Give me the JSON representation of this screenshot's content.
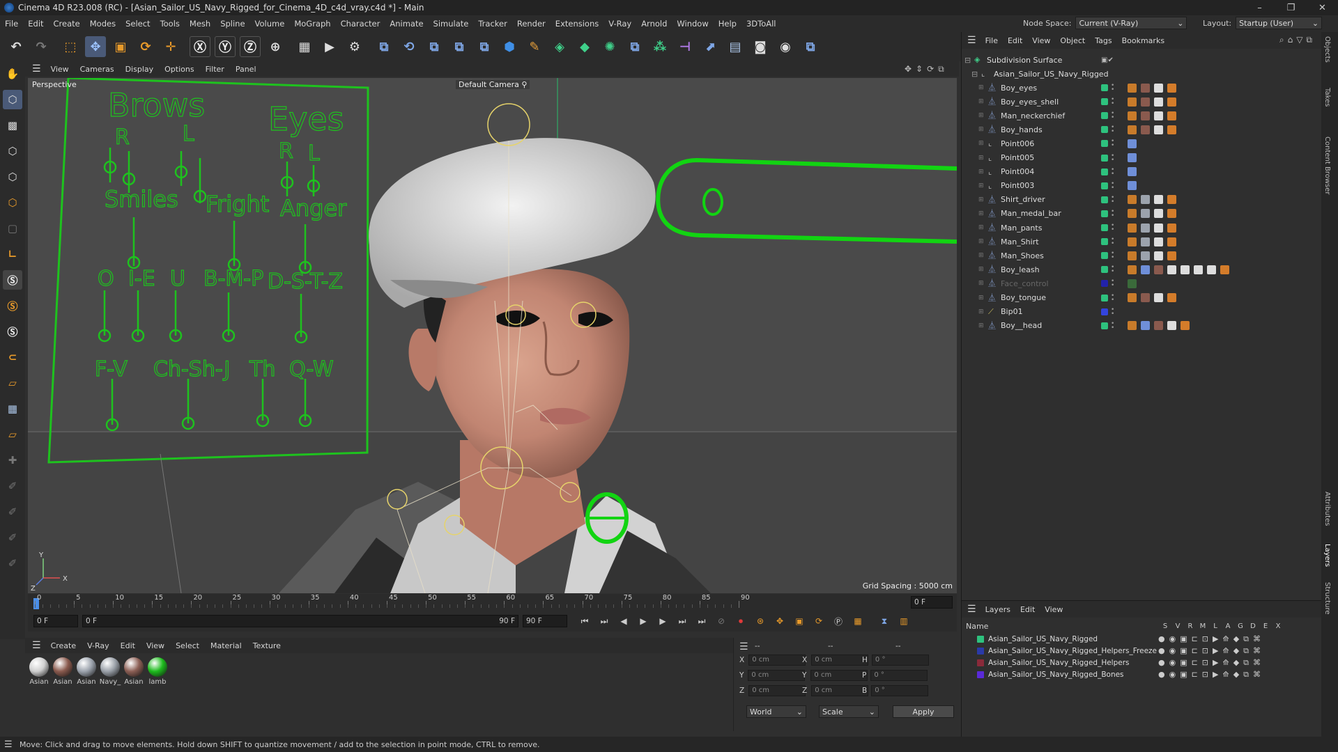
{
  "window": {
    "title": "Cinema 4D R23.008 (RC) - [Asian_Sailor_US_Navy_Rigged_for_Cinema_4D_c4d_vray.c4d *] - Main",
    "controls": [
      "–",
      "❐",
      "✕"
    ]
  },
  "menubar": {
    "items": [
      "File",
      "Edit",
      "Create",
      "Modes",
      "Select",
      "Tools",
      "Mesh",
      "Spline",
      "Volume",
      "MoGraph",
      "Character",
      "Animate",
      "Simulate",
      "Tracker",
      "Render",
      "Extensions",
      "V-Ray",
      "Arnold",
      "Window",
      "Help",
      "3DToAll"
    ],
    "node_space_label": "Node Space:",
    "node_space_value": "Current (V-Ray)",
    "layout_label": "Layout:",
    "layout_value": "Startup (User)"
  },
  "viewport": {
    "menu": [
      "View",
      "Cameras",
      "Display",
      "Options",
      "Filter",
      "Panel"
    ],
    "view_name": "Perspective",
    "camera": "Default Camera",
    "grid_spacing": "Grid Spacing : 5000 cm",
    "face_labels": {
      "brows": "Brows",
      "eyes": "Eyes",
      "r1": "R",
      "l1": "L",
      "r2": "R",
      "l2": "L",
      "smiles": "Smiles",
      "fright": "Fright",
      "anger": "Anger",
      "o": "O",
      "ie": "I-E",
      "u": "U",
      "bmp": "B-M-P",
      "dstz": "D-S-T-Z",
      "fv": "F-V",
      "chshj": "Ch-Sh-J",
      "th": "Th",
      "qw": "Q-W"
    },
    "axis_y": "Y",
    "axis_z": "Z",
    "axis_x": "X"
  },
  "timeline": {
    "ticks": [
      "0",
      "5",
      "10",
      "15",
      "20",
      "25",
      "30",
      "35",
      "40",
      "45",
      "50",
      "55",
      "60",
      "65",
      "70",
      "75",
      "80",
      "85",
      "90"
    ],
    "frame_readout": "0 F",
    "start": "0 F",
    "current": "0 F",
    "end_inner": "90 F",
    "end": "90 F"
  },
  "material_manager": {
    "menu": [
      "Create",
      "V-Ray",
      "Edit",
      "View",
      "Select",
      "Material",
      "Texture"
    ],
    "materials": [
      {
        "label": "Asian",
        "color": "#cfcfcf"
      },
      {
        "label": "Asian",
        "color": "#8a5a4e"
      },
      {
        "label": "Asian",
        "color": "#9ca3ad"
      },
      {
        "label": "Navy_",
        "color": "#9aa0a8"
      },
      {
        "label": "Asian",
        "color": "#8c5f55"
      },
      {
        "label": "lamb",
        "color": "#1dbb1d"
      }
    ]
  },
  "coordinates": {
    "header": [
      "--",
      "--",
      "--"
    ],
    "rows": [
      {
        "a": "X",
        "av": "0 cm",
        "b": "X",
        "bv": "0 cm",
        "c": "H",
        "cv": "0 °"
      },
      {
        "a": "Y",
        "av": "0 cm",
        "b": "Y",
        "bv": "0 cm",
        "c": "P",
        "cv": "0 °"
      },
      {
        "a": "Z",
        "av": "0 cm",
        "b": "Z",
        "bv": "0 cm",
        "c": "B",
        "cv": "0 °"
      }
    ],
    "space": "World",
    "mode": "Scale",
    "apply": "Apply"
  },
  "object_manager": {
    "menu": [
      "File",
      "Edit",
      "View",
      "Object",
      "Tags",
      "Bookmarks"
    ],
    "root": "Subdivision Surface",
    "group": "Asian_Sailor_US_Navy_Rigged",
    "objects": [
      {
        "name": "Boy_eyes",
        "icon": "polygon-icon",
        "vis": "#2ec27e",
        "tags": [
          "#c87b2a",
          "#8a5a4e",
          "#dddddd",
          "#d47c2a"
        ]
      },
      {
        "name": "Boy_eyes_shell",
        "icon": "polygon-icon",
        "vis": "#2ec27e",
        "tags": [
          "#c87b2a",
          "#8a5a4e",
          "#dddddd",
          "#d47c2a"
        ]
      },
      {
        "name": "Man_neckerchief",
        "icon": "polygon-icon",
        "vis": "#2ec27e",
        "tags": [
          "#c87b2a",
          "#8a5a4e",
          "#dddddd",
          "#d47c2a"
        ]
      },
      {
        "name": "Boy_hands",
        "icon": "polygon-icon",
        "vis": "#2ec27e",
        "tags": [
          "#c87b2a",
          "#8a5a4e",
          "#dddddd",
          "#d47c2a"
        ]
      },
      {
        "name": "Point006",
        "icon": "null-icon",
        "vis": "#2ec27e",
        "tags": [
          "#6f8fd8"
        ]
      },
      {
        "name": "Point005",
        "icon": "null-icon",
        "vis": "#2ec27e",
        "tags": [
          "#6f8fd8"
        ]
      },
      {
        "name": "Point004",
        "icon": "null-icon",
        "vis": "#2ec27e",
        "tags": [
          "#6f8fd8"
        ]
      },
      {
        "name": "Point003",
        "icon": "null-icon",
        "vis": "#2ec27e",
        "tags": [
          "#6f8fd8"
        ]
      },
      {
        "name": "Shirt_driver",
        "icon": "polygon-icon",
        "vis": "#2ec27e",
        "tags": [
          "#c87b2a",
          "#9ca3ad",
          "#dddddd",
          "#d47c2a"
        ]
      },
      {
        "name": "Man_medal_bar",
        "icon": "polygon-icon",
        "vis": "#2ec27e",
        "tags": [
          "#c87b2a",
          "#9ca3ad",
          "#dddddd",
          "#d47c2a"
        ]
      },
      {
        "name": "Man_pants",
        "icon": "polygon-icon",
        "vis": "#2ec27e",
        "tags": [
          "#c87b2a",
          "#9ca3ad",
          "#dddddd",
          "#d47c2a"
        ]
      },
      {
        "name": "Man_Shirt",
        "icon": "polygon-icon",
        "vis": "#2ec27e",
        "tags": [
          "#c87b2a",
          "#9ca3ad",
          "#dddddd",
          "#d47c2a"
        ]
      },
      {
        "name": "Man_Shoes",
        "icon": "polygon-icon",
        "vis": "#2ec27e",
        "tags": [
          "#c87b2a",
          "#9ca3ad",
          "#dddddd",
          "#d47c2a"
        ]
      },
      {
        "name": "Boy_leash",
        "icon": "polygon-icon",
        "vis": "#2ec27e",
        "tags": [
          "#c87b2a",
          "#6f8fd8",
          "#8a5a4e",
          "#dddddd",
          "#dddddd",
          "#dddddd",
          "#dddddd",
          "#d47c2a"
        ]
      },
      {
        "name": "Face_control",
        "icon": "polygon-icon",
        "vis": "#2222aa",
        "tags": [
          "#3a6a3a"
        ],
        "dim": true
      },
      {
        "name": "Boy_tongue",
        "icon": "polygon-icon",
        "vis": "#2ec27e",
        "tags": [
          "#c87b2a",
          "#8a5a4e",
          "#dddddd",
          "#d47c2a"
        ]
      },
      {
        "name": "Bip01",
        "icon": "bone-icon",
        "vis": "#3344dd",
        "tags": []
      },
      {
        "name": "Boy__head",
        "icon": "polygon-icon",
        "vis": "#2ec27e",
        "tags": [
          "#c87b2a",
          "#6f8fd8",
          "#8a5a4e",
          "#dddddd",
          "#d47c2a"
        ]
      }
    ]
  },
  "layers": {
    "menu": [
      "Layers",
      "Edit",
      "View"
    ],
    "header_name": "Name",
    "header_cols": [
      "S",
      "V",
      "R",
      "M",
      "L",
      "A",
      "G",
      "D",
      "E",
      "X"
    ],
    "items": [
      {
        "name": "Asian_Sailor_US_Navy_Rigged",
        "color": "#2ec27e"
      },
      {
        "name": "Asian_Sailor_US_Navy_Rigged_Helpers_Freeze",
        "color": "#2a3aa8"
      },
      {
        "name": "Asian_Sailor_US_Navy_Rigged_Helpers",
        "color": "#8a2a3a"
      },
      {
        "name": "Asian_Sailor_US_Navy_Rigged_Bones",
        "color": "#5a2ad8"
      }
    ]
  },
  "right_strip": [
    "Objects",
    "Takes",
    "Content Browser",
    "Attributes",
    "Layers",
    "Structure"
  ],
  "status": "Move: Click and drag to move elements. Hold down SHIFT to quantize movement / add to the selection in point mode, CTRL to remove."
}
